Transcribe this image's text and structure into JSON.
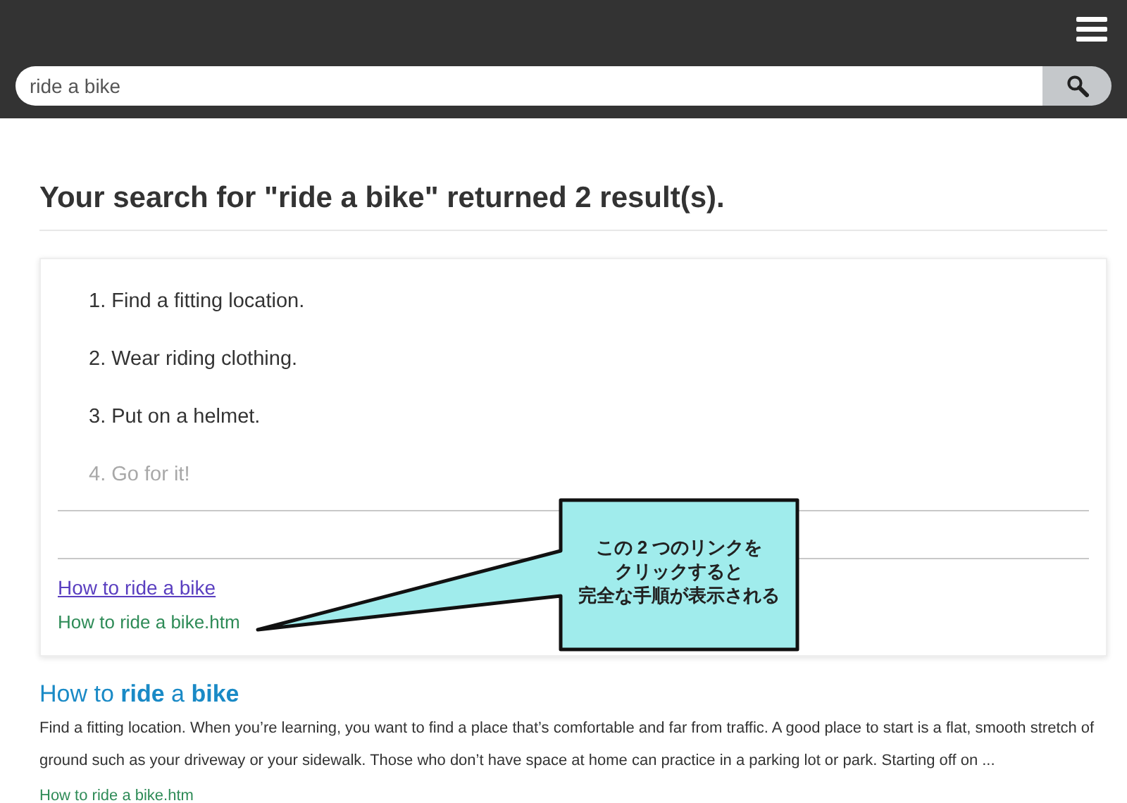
{
  "header": {
    "search": {
      "value": "ride a bike"
    }
  },
  "heading": "Your search for \"ride a bike\" returned 2 result(s).",
  "results": [
    {
      "kind": "steps",
      "steps": [
        {
          "number": "1.",
          "text": "Find a fitting location.",
          "faded": false
        },
        {
          "number": "2.",
          "text": "Wear riding clothing.",
          "faded": false
        },
        {
          "number": "3.",
          "text": "Put on a helmet.",
          "faded": false
        },
        {
          "number": "4.",
          "text": "Go for it!",
          "faded": true
        }
      ],
      "link": {
        "text": "How to ride a bike",
        "visited": true
      },
      "url": "How to ride a bike.htm"
    },
    {
      "kind": "snippet",
      "title": "How to **ride** a **bike**",
      "snippet": "Find a fitting location. When you’re learning, you want to find a place that’s comfortable and far from traffic. A good place to start is a flat, smooth stretch of ground such as your driveway or your sidewalk. Those who don’t have space at home can practice in a parking lot or park. Starting off on ...",
      "url": "How to ride a bike.htm"
    }
  ],
  "callout": {
    "lines": [
      "この 2 つのリンクを",
      "クリックすると",
      "完全な手順が表示される"
    ]
  }
}
